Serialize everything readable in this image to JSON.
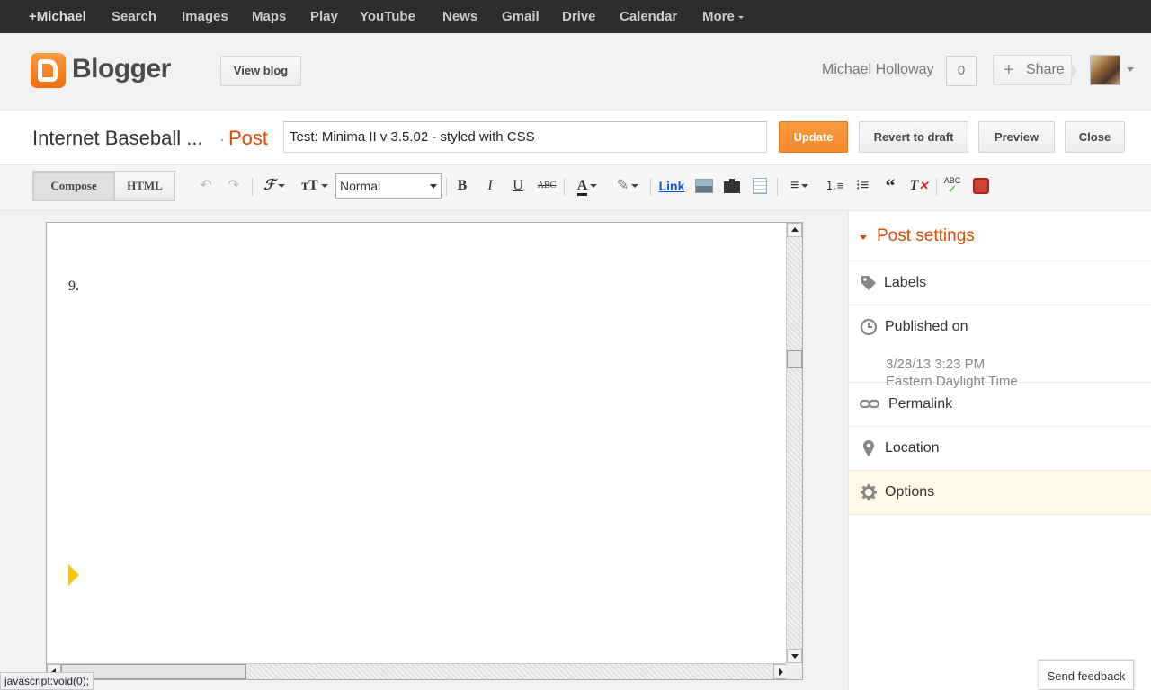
{
  "gbar": {
    "items": [
      "+Michael",
      "Search",
      "Images",
      "Maps",
      "Play",
      "YouTube",
      "News",
      "Gmail",
      "Drive",
      "Calendar",
      "More"
    ]
  },
  "header": {
    "logo_text": "Blogger",
    "view_blog": "View blog",
    "user_name": "Michael Holloway",
    "notification_count": "0",
    "share": "Share"
  },
  "titlebar": {
    "blog_name": "Internet Baseball ...",
    "crumb_separator": "·",
    "crumb": "Post",
    "post_title": "Test: Minima II v 3.5.02 - styled with CSS",
    "update": "Update",
    "revert": "Revert to draft",
    "preview": "Preview",
    "close": "Close"
  },
  "toolbar": {
    "compose": "Compose",
    "html": "HTML",
    "format_value": "Normal",
    "link": "Link",
    "bold": "B",
    "italic": "I",
    "underline": "U",
    "strike": "ABC",
    "font_color": "A"
  },
  "editor": {
    "text": "9."
  },
  "sidebar": {
    "title": "Post settings",
    "labels": "Labels",
    "published_on": "Published on",
    "published_date": "3/28/13 3:23 PM",
    "published_tz": "Eastern Daylight Time",
    "permalink": "Permalink",
    "location": "Location",
    "options": "Options"
  },
  "feedback": "Send feedback",
  "status_text": "javascript:void(0);",
  "colors": {
    "accent": "#dd4b05",
    "update_button": "#f4882c",
    "gbar": "#2d2d2d"
  }
}
